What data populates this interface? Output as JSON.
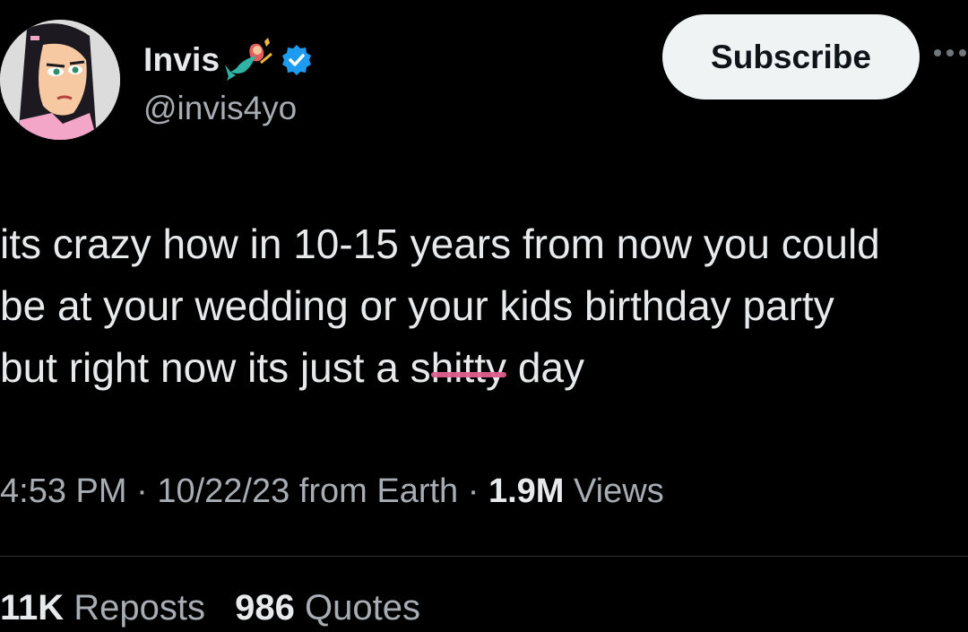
{
  "author": {
    "display_name": "Invis",
    "handle": "@invis4yo",
    "name_emoji": "mermaid-icon",
    "verified_badge": "verified-icon",
    "avatar": "avatar"
  },
  "header": {
    "subscribe_label": "Subscribe",
    "more_icon": "more-icon"
  },
  "tweet": {
    "line1": "its crazy how in 10-15 years from now you could",
    "line2": "be at your wedding or your kids birthday party",
    "line3_before": "but right now its just a s",
    "line3_censored": "hitty",
    "line3_after": " day"
  },
  "meta": {
    "time": "4:53 PM",
    "sep1": " · ",
    "date": "10/22/23",
    "source": " from Earth",
    "sep2": " · ",
    "views_count": "1.9M",
    "views_label": " Views"
  },
  "stats": {
    "reposts_count": "11K",
    "reposts_label": "Reposts",
    "quotes_count": "986",
    "quotes_label": "Quotes"
  },
  "colors": {
    "background": "#000000",
    "text_primary": "#e7e9ea",
    "text_secondary": "#a7adb3",
    "verified_blue": "#1d9bf0",
    "censor_pink": "#e0608e",
    "subscribe_bg": "#eff3f4"
  }
}
